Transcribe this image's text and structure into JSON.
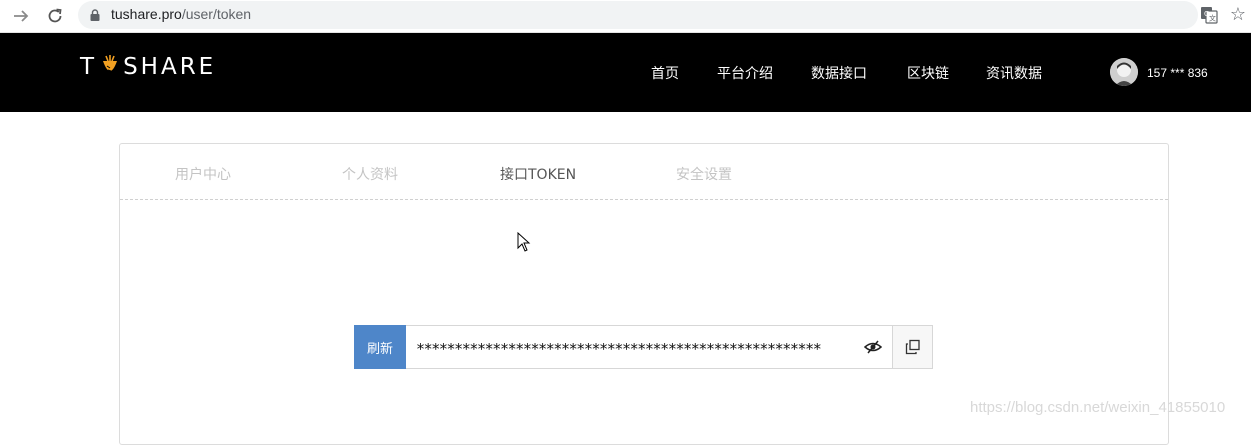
{
  "browser": {
    "url_host": "tushare.pro",
    "url_path": "/user/token",
    "icons": [
      "forward-icon",
      "reload-icon",
      "lock-icon",
      "translate-icon",
      "star-icon"
    ]
  },
  "header": {
    "logo_left": "T",
    "logo_right": "SHARE",
    "nav": [
      "首页",
      "平台介绍",
      "数据接口",
      "区块链",
      "资讯数据"
    ],
    "user": "157 *** 836"
  },
  "tabs": [
    {
      "label": "用户中心",
      "active": false
    },
    {
      "label": "个人资料",
      "active": false
    },
    {
      "label": "接口TOKEN",
      "active": true
    },
    {
      "label": "安全设置",
      "active": false
    }
  ],
  "token": {
    "refresh_label": "刷新",
    "masked_value": "*****************************************************"
  },
  "watermark": "https://blog.csdn.net/weixin_41855010",
  "colors": {
    "header_bg": "#000000",
    "accent": "#4e86c9",
    "logo_carrot": "#f2a022"
  }
}
